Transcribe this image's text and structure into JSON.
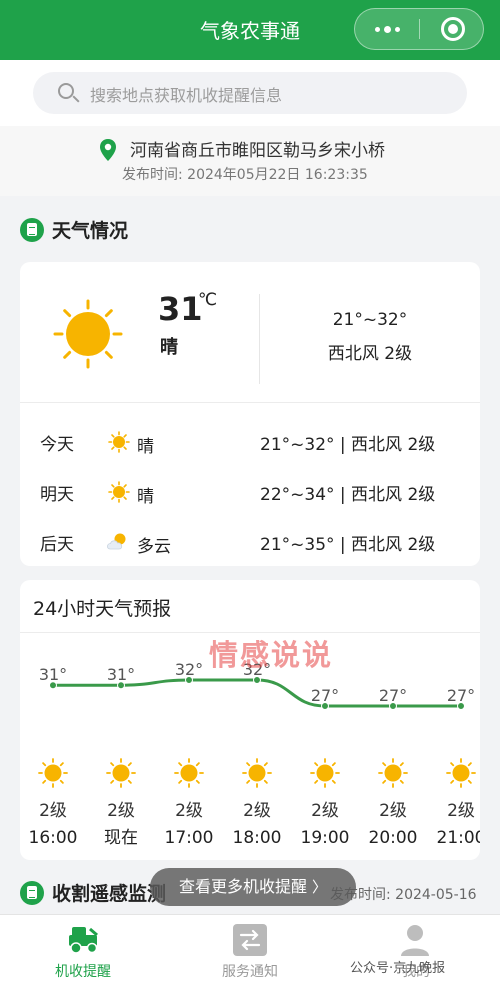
{
  "app": {
    "title": "气象农事通"
  },
  "search": {
    "placeholder": "搜索地点获取机收提醒信息"
  },
  "location": {
    "address": "河南省商丘市睢阳区勒马乡宋小桥",
    "publish_label": "发布时间:",
    "publish_time": "2024年05月22日 16:23:35"
  },
  "weather_section": {
    "title": "天气情况"
  },
  "current": {
    "temp": "31",
    "unit": "℃",
    "condition": "晴",
    "range": "21°~32°",
    "wind": "西北风 2级",
    "icon": "sun-icon"
  },
  "days": [
    {
      "day": "今天",
      "icon": "sun-icon",
      "condition": "晴",
      "summary": "21°~32° | 西北风 2级"
    },
    {
      "day": "明天",
      "icon": "sun-icon",
      "condition": "晴",
      "summary": "22°~34° | 西北风 2级"
    },
    {
      "day": "后天",
      "icon": "partly-cloudy-icon",
      "condition": "多云",
      "summary": "21°~35° | 西北风 2级"
    }
  ],
  "forecast": {
    "title": "24小时天气预报"
  },
  "chart_data": {
    "type": "line",
    "title": "",
    "x": [
      "16:00",
      "现在",
      "17:00",
      "18:00",
      "19:00",
      "20:00",
      "21:00"
    ],
    "series": [
      {
        "values": [
          31,
          31,
          32,
          32,
          27,
          27,
          27
        ]
      }
    ],
    "temp_labels": [
      "31°",
      "31°",
      "32°",
      "32°",
      "27°",
      "27°",
      "27°"
    ],
    "wind_labels": [
      "2级",
      "2级",
      "2级",
      "2级",
      "2级",
      "2级",
      "2级"
    ],
    "icons": [
      "sun-icon",
      "sun-icon",
      "sun-icon",
      "sun-icon",
      "sun-icon",
      "sun-icon",
      "sun-icon"
    ],
    "line_color": "#3a9a4a"
  },
  "watermark": "情感说说",
  "harvest": {
    "title": "收割遥感监测",
    "date_label": "发布时间:",
    "date": "2024-05-16"
  },
  "toast": {
    "label": "查看更多机收提醒"
  },
  "tabs": [
    {
      "label": "机收提醒",
      "active": true,
      "icon": "harvester-icon"
    },
    {
      "label": "服务通知",
      "active": false,
      "icon": "swap-icon"
    },
    {
      "label": "我的",
      "active": false,
      "icon": "user-icon"
    }
  ],
  "footer_watermark": "公众号·京九晚报",
  "colors": {
    "brand": "#1fa24a",
    "sun": "#f7b400"
  }
}
